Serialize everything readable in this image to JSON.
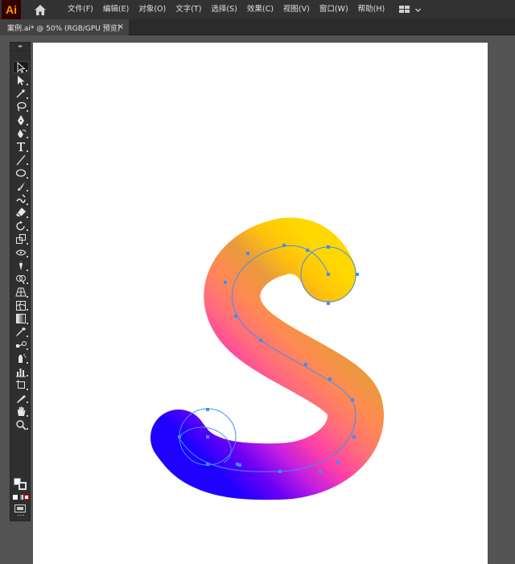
{
  "app": {
    "logo_text": "Ai"
  },
  "menu": [
    "文件(F)",
    "编辑(E)",
    "对象(O)",
    "文字(T)",
    "选择(S)",
    "效果(C)",
    "视图(V)",
    "窗口(W)",
    "帮助(H)"
  ],
  "document_tab": {
    "title": "案例.ai* @ 50% (RGB/GPU 预览)",
    "close": "×"
  },
  "toolbar": {
    "tools": [
      "selection-tool",
      "direct-selection-tool",
      "magic-wand-tool",
      "lasso-tool",
      "pen-tool",
      "curvature-tool",
      "type-tool",
      "line-segment-tool",
      "ellipse-tool",
      "paintbrush-tool",
      "shaper-tool",
      "eraser-tool",
      "rotate-tool",
      "scale-tool",
      "width-tool",
      "puppet-warp-tool",
      "shape-builder-tool",
      "perspective-grid-tool",
      "mesh-tool",
      "gradient-tool",
      "eyedropper-tool",
      "blend-tool",
      "symbol-sprayer-tool",
      "column-graph-tool",
      "artboard-tool",
      "slice-tool",
      "hand-tool",
      "zoom-tool"
    ],
    "active_tool": "selection-tool"
  },
  "artwork": {
    "gradient_colors": [
      "#1e00ff",
      "#6a00f4",
      "#c21fe0",
      "#ff3fa8",
      "#ff6e7a",
      "#ff8a52",
      "#e99a3c",
      "#ffc30a",
      "#ffd800"
    ],
    "anchor_color": "#3d8eff"
  }
}
